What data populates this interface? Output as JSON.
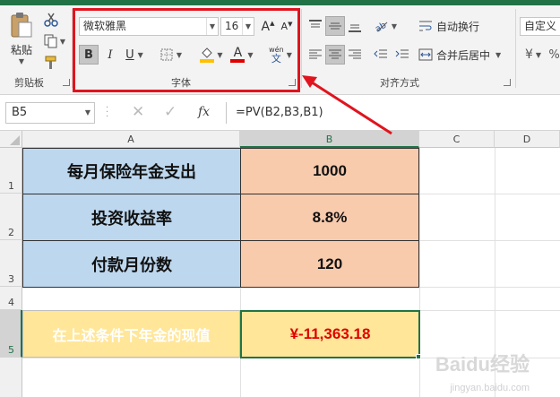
{
  "ribbon": {
    "clipboard": {
      "paste_label": "粘贴",
      "group_label": "剪贴板"
    },
    "font": {
      "font_name": "微软雅黑",
      "font_size": "16",
      "grow_label": "A",
      "shrink_label": "A",
      "bold_label": "B",
      "italic_label": "I",
      "underline_label": "U",
      "font_color_label": "A",
      "phonetic_label": "wén",
      "phonetic_sub": "文",
      "group_label": "字体"
    },
    "alignment": {
      "wrap_label": "自动换行",
      "merge_label": "合并后居中",
      "group_label": "对齐方式"
    },
    "number": {
      "format_label": "自定义",
      "currency_symbol": "¥"
    },
    "colors": {
      "accent": "#217346",
      "highlight": "#e0141e",
      "fill_yellow": "#ffc000",
      "font_red": "#e00000"
    }
  },
  "formula_bar": {
    "name_box": "B5",
    "fx_label": "fx",
    "formula": "=PV(B2,B3,B1)"
  },
  "columns": [
    "A",
    "B",
    "C",
    "D"
  ],
  "rows": [
    "1",
    "2",
    "3",
    "4",
    "5"
  ],
  "cells": {
    "a1": "每月保险年金支出",
    "b1": "1000",
    "a2": "投资收益率",
    "b2": "8.8%",
    "a3": "付款月份数",
    "b3": "120",
    "a5": "在上述条件下年金的现值",
    "b5": "¥-11,363.18"
  },
  "cell_colors": {
    "label_fill": "#bdd7ee",
    "value_fill": "#f8cbad",
    "result_fill": "#ffe699",
    "result_text": "#e00000"
  },
  "watermark": {
    "logo": "Baidu经验",
    "url": "jingyan.baidu.com"
  }
}
